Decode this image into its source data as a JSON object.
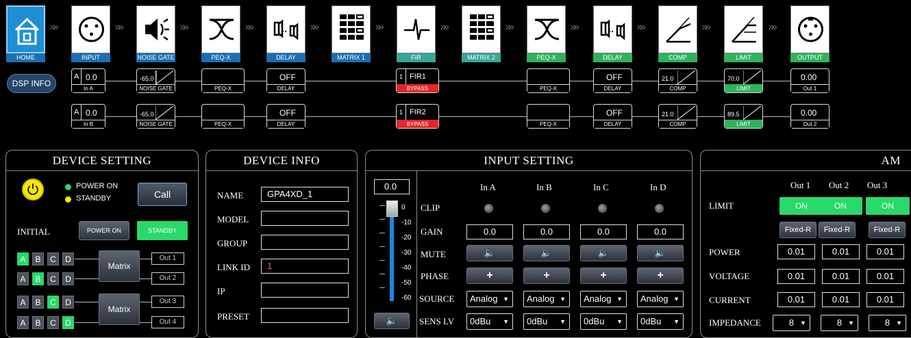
{
  "toolbar": {
    "items": [
      {
        "label": "HOME",
        "icon": "home-icon",
        "color": "blue"
      },
      {
        "label": "INPUT",
        "icon": "xlr-input-icon",
        "color": "blue"
      },
      {
        "label": "NOISE GATE",
        "icon": "noise-gate-speaker-icon",
        "color": "blue"
      },
      {
        "label": "PEQ-X",
        "icon": "peq-curve-icon",
        "color": "blue"
      },
      {
        "label": "DELAY",
        "icon": "delay-speaker-icon",
        "color": "blue"
      },
      {
        "label": "MATRIX 1",
        "icon": "matrix-grid-icon",
        "color": "blue"
      },
      {
        "label": "FIR",
        "icon": "fir-pulse-icon",
        "color": "teal"
      },
      {
        "label": "MATRIX 2",
        "icon": "matrix-grid-icon",
        "color": "teal"
      },
      {
        "label": "PEQ-X",
        "icon": "peq-curve-icon",
        "color": "green"
      },
      {
        "label": "DELAY",
        "icon": "delay-speaker-icon",
        "color": "green"
      },
      {
        "label": "COMP",
        "icon": "compressor-curve-icon",
        "color": "green"
      },
      {
        "label": "LIMIT",
        "icon": "limiter-curve-icon",
        "color": "green"
      },
      {
        "label": "OUTPUT",
        "icon": "xlr-output-icon",
        "color": "green"
      }
    ]
  },
  "dsp_info_label": "DSP INFO",
  "chain": [
    {
      "in_letter": "A",
      "in_value": "0.0",
      "in_name": "In A",
      "gate_value": "-65.0",
      "gate_label": "NOISE GATE",
      "peq1": "PEQ-X",
      "delay1_value": "OFF",
      "delay1_label": "DELAY",
      "fir_num": "1",
      "fir_name": "FIR1",
      "fir_state": "BYPASS",
      "peq2": "PEQ-X",
      "delay2_value": "OFF",
      "delay2_label": "DELAY",
      "comp_value": "21.0",
      "comp_label": "COMP",
      "limit_value": "70.0",
      "limit_label": "LIMIT",
      "out_value": "0.00",
      "out_name": "Out 1"
    },
    {
      "in_letter": "A",
      "in_value": "0.0",
      "in_name": "In B",
      "gate_value": "-65.0",
      "gate_label": "NOISE GATE",
      "peq1": "PEQ-X",
      "delay1_value": "OFF",
      "delay1_label": "DELAY",
      "fir_num": "1",
      "fir_name": "FIR2",
      "fir_state": "BYPASS",
      "peq2": "PEQ-X",
      "delay2_value": "OFF",
      "delay2_label": "DELAY",
      "comp_value": "21.0",
      "comp_label": "COMP",
      "limit_value": "89.5",
      "limit_label": "LIMIT",
      "out_value": "0.00",
      "out_name": "Out 2"
    }
  ],
  "device_setting": {
    "title": "DEVICE SETTING",
    "power_on": "POWER ON",
    "standby": "STANDBY",
    "call": "Call",
    "initial": "INITIAL",
    "power_on_btn": "POWER ON",
    "standby_btn": "STANDBY",
    "matrix_label": "Matrix",
    "rows": [
      {
        "active": "A",
        "out": "Out 1"
      },
      {
        "active": "B",
        "out": "Out 2"
      },
      {
        "active": "C",
        "out": "Out 3"
      },
      {
        "active": "D",
        "out": "Out 4"
      }
    ],
    "letters": [
      "A",
      "B",
      "C",
      "D"
    ]
  },
  "device_info": {
    "title": "DEVICE INFO",
    "fields": [
      {
        "label": "NAME",
        "value": "GPA4XD_1"
      },
      {
        "label": "MODEL",
        "value": ""
      },
      {
        "label": "GROUP",
        "value": ""
      },
      {
        "label": "LINK ID",
        "value": "1"
      },
      {
        "label": "IP",
        "value": ""
      },
      {
        "label": "PRESET",
        "value": ""
      }
    ]
  },
  "input_setting": {
    "title": "INPUT SETTING",
    "fader_value": "0.0",
    "scale": [
      "0",
      "-10",
      "-20",
      "-30",
      "-40",
      "-50",
      "-60"
    ],
    "channels": [
      "In A",
      "In B",
      "In C",
      "In D"
    ],
    "rows": {
      "clip": "CLIP",
      "gain": "GAIN",
      "mute": "MUTE",
      "phase": "PHASE",
      "source": "SOURCE",
      "sens": "SENS LV"
    },
    "gain_values": [
      "0.0",
      "0.0",
      "0.0",
      "0.0"
    ],
    "phase_symbol": "+",
    "source_values": [
      "Analog",
      "Analog",
      "Analog",
      "Analog"
    ],
    "sens_values": [
      "0dBu",
      "0dBu",
      "0dBu",
      "0dBu"
    ]
  },
  "amp_setting": {
    "title": "AM",
    "outputs": [
      "Out 1",
      "Out 2",
      "Out 3"
    ],
    "labels": {
      "limit": "LIMIT",
      "power": "POWER",
      "voltage": "VOLTAGE",
      "current": "CURRENT",
      "impedance": "IMPEDANCE"
    },
    "limit_state": [
      "ON",
      "ON",
      "ON"
    ],
    "mode": [
      "Fixed-R",
      "Fixed-R",
      "Fixed-R"
    ],
    "power": [
      "0.01",
      "0.01",
      "0.01"
    ],
    "voltage": [
      "0.01",
      "0.01",
      "0.01"
    ],
    "current": [
      "0.01",
      "0.01",
      "0.01"
    ],
    "impedance": [
      "8",
      "8",
      "8"
    ]
  },
  "colors": {
    "accent_green": "#29d96a",
    "bypass_red": "#e3262b",
    "home_blue": "#1e8fd6"
  }
}
